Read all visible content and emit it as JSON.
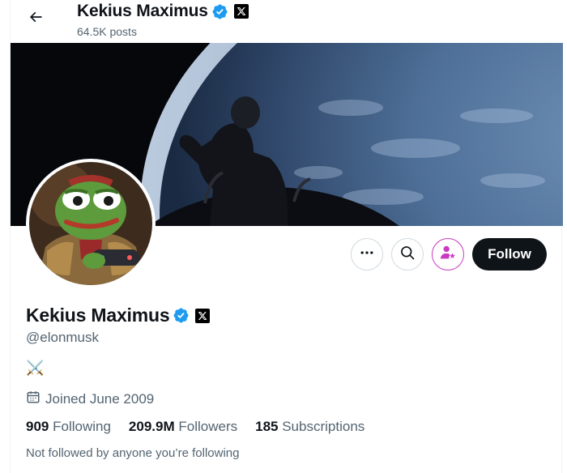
{
  "header": {
    "back_icon": "arrow-left-icon",
    "display_name": "Kekius Maximus",
    "posts_count": "64.5K posts"
  },
  "badges": {
    "verified_icon": "verified-badge-icon",
    "verified_color": "#1d9bf0",
    "affiliate_icon": "x-logo-icon"
  },
  "profile": {
    "display_name": "Kekius Maximus",
    "handle": "@elonmusk",
    "bio": "⚔️",
    "joined_icon": "calendar-icon",
    "joined": "Joined June 2009",
    "following_count": "909",
    "following_label": "Following",
    "followers_count": "209.9M",
    "followers_label": "Followers",
    "subscriptions_count": "185",
    "subscriptions_label": "Subscriptions",
    "followed_note": "Not followed by anyone you’re following"
  },
  "actions": {
    "more_icon": "more-dots-icon",
    "search_icon": "search-icon",
    "subscribe_icon": "subscribe-star-icon",
    "subscribe_color": "#c93ac0",
    "follow_label": "Follow"
  },
  "colors": {
    "text_primary": "#0f1419",
    "text_secondary": "#536471",
    "border": "#cfd9de"
  }
}
